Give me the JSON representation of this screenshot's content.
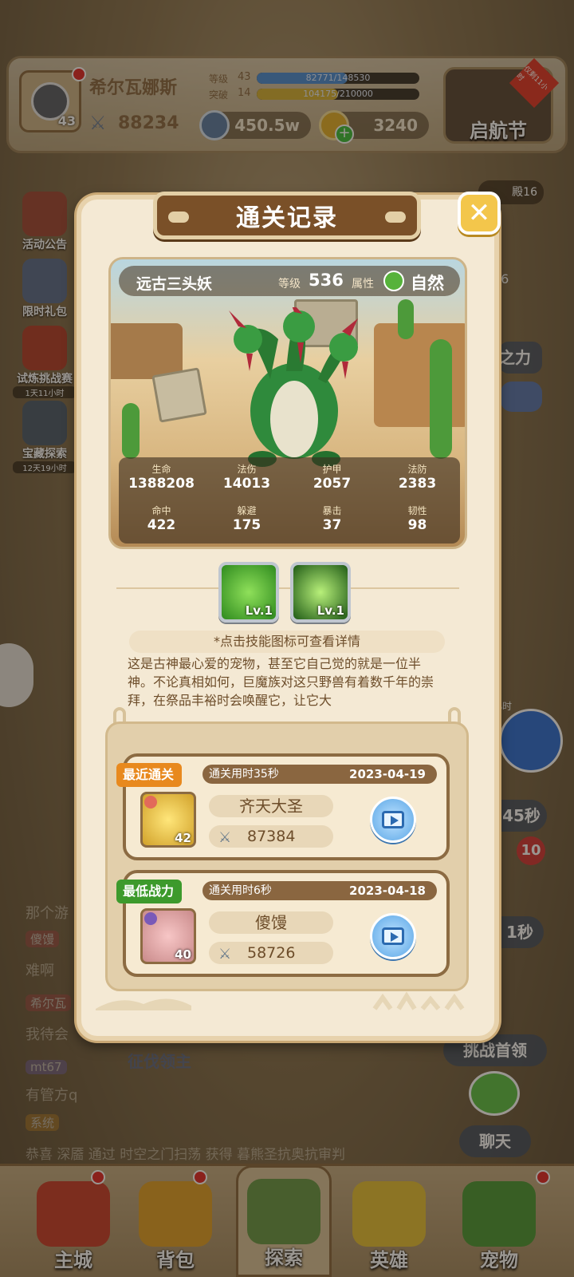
{
  "player": {
    "name": "希尔瓦娜斯",
    "avatar_level": "43",
    "level_label": "等级",
    "level": "43",
    "level_progress": "82771/148530",
    "breakthrough_label": "突破",
    "breakthrough": "14",
    "breakthrough_progress": "104175/210000",
    "power": "88234",
    "resource_1": "450.5w",
    "resource_2": "3240"
  },
  "event": {
    "label": "启航节",
    "tag": "仅剩11小时"
  },
  "side_menu": [
    {
      "label": "活动公告",
      "sub": ""
    },
    {
      "label": "限时礼包",
      "sub": ""
    },
    {
      "label": "试炼挑战赛",
      "sub": "1天11小时"
    },
    {
      "label": "宝藏探索",
      "sub": "12天19小时"
    }
  ],
  "right_menu": {
    "challenge": "挑战首领",
    "chat": "聊天",
    "power_word": "之力",
    "timer_1": "45秒",
    "timer_2": "1秒",
    "badge": "10",
    "small_time": "小时",
    "map_title": "殿16",
    "map_num": "16"
  },
  "chat": [
    {
      "tag": "",
      "text": "那个游"
    },
    {
      "tag": "傻馒",
      "text": ""
    },
    {
      "tag": "",
      "text": "难啊"
    },
    {
      "tag": "希尔瓦",
      "text": ""
    },
    {
      "tag": "",
      "text": "我待会"
    },
    {
      "tag": "mt67",
      "text": ""
    },
    {
      "tag": "",
      "text": "有管方q"
    },
    {
      "tag": "系统",
      "text": ""
    },
    {
      "tag": "",
      "text": "恭喜 深靥 通过 时空之门扫荡 获得 暮熊圣抗奥抗审判"
    }
  ],
  "conquer_banner": "征伐领主",
  "dialog": {
    "title": "通关记录",
    "close": "✕",
    "boss": {
      "name": "远古三头妖",
      "level_label": "等级",
      "level": "536",
      "attr_label": "属性",
      "attr": "自然",
      "stats": [
        {
          "label": "生命",
          "value": "1388208"
        },
        {
          "label": "法伤",
          "value": "14013"
        },
        {
          "label": "护甲",
          "value": "2057"
        },
        {
          "label": "法防",
          "value": "2383"
        },
        {
          "label": "命中",
          "value": "422"
        },
        {
          "label": "躲避",
          "value": "175"
        },
        {
          "label": "暴击",
          "value": "37"
        },
        {
          "label": "韧性",
          "value": "98"
        }
      ]
    },
    "skills": [
      {
        "level": "Lv.1",
        "color": "#3fa82e"
      },
      {
        "level": "Lv.1",
        "color": "#2e6d1f"
      }
    ],
    "tip": "*点击技能图标可查看详情",
    "description": "这是古神最心爱的宠物，甚至它自己觉的就是一位半神。不论真相如何，巨魔族对这只野兽有着数千年的崇拜，在祭品丰裕时会唤醒它，让它大",
    "records": [
      {
        "tag": "最近通关",
        "tag_color": "#e8891e",
        "time": "通关用时35秒",
        "date": "2023-04-19",
        "hero_name": "齐天大圣",
        "hero_level": "42",
        "power": "87384"
      },
      {
        "tag": "最低战力",
        "tag_color": "#3d9a2c",
        "time": "通关用时6秒",
        "date": "2023-04-18",
        "hero_name": "傻馒",
        "hero_level": "40",
        "power": "58726"
      }
    ]
  },
  "bottom_nav": [
    {
      "label": "主城"
    },
    {
      "label": "背包"
    },
    {
      "label": "探索"
    },
    {
      "label": "英雄"
    },
    {
      "label": "宠物"
    }
  ]
}
